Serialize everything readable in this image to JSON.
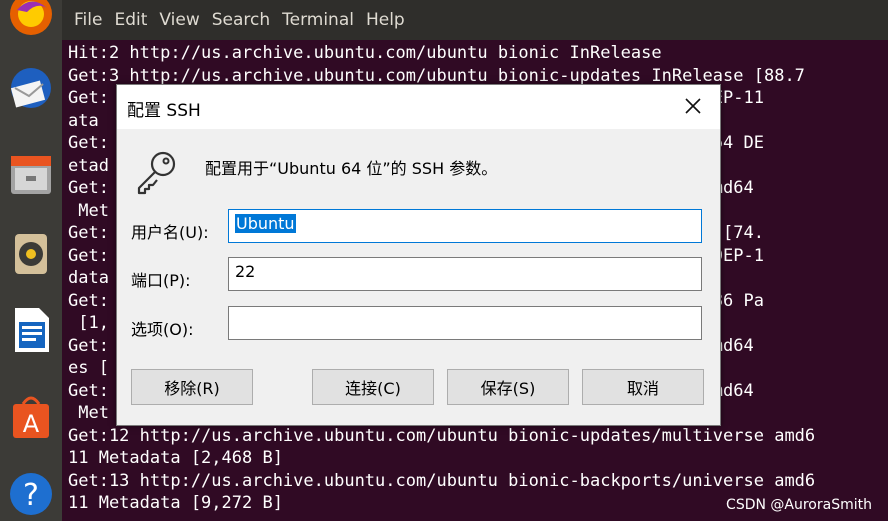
{
  "terminal": {
    "menu": [
      "File",
      "Edit",
      "View",
      "Search",
      "Terminal",
      "Help"
    ],
    "lines": [
      "Hit:2 http://us.archive.ubuntu.com/ubuntu bionic InRelease",
      "Get:3 http://us.archive.ubuntu.com/ubuntu bionic-updates InRelease [88.7",
      "Get:                                                 in amd64 DEP-11",
      "ata",
      "Get:                                                 iverse amd64 DE",
      "etad",
      "Get:                                                 ltiverse amd64",
      " Met",
      "Get:                                                  InRelease [74.",
      "Get:                                                 ain amd64 DEP-1",
      "data",
      "Get:                                                 niverse i386 Pa",
      " [1,",
      "Get:                                                 universe amd64",
      "es [",
      "Get:                                                 universe amd64",
      " Met",
      "Get:12 http://us.archive.ubuntu.com/ubuntu bionic-updates/multiverse amd6",
      "11 Metadata [2,468 B]",
      "Get:13 http://us.archive.ubuntu.com/ubuntu bionic-backports/universe amd6",
      "11 Metadata [9,272 B]"
    ]
  },
  "dialog": {
    "title": "配置 SSH",
    "description": "配置用于“Ubuntu 64 位”的 SSH 参数。",
    "username_label": "用户名(U):",
    "username_value": "Ubuntu",
    "port_label": "端口(P):",
    "port_value": "22",
    "options_label": "选项(O):",
    "options_value": "",
    "buttons": {
      "remove": "移除(R)",
      "connect": "连接(C)",
      "save": "保存(S)",
      "cancel": "取消"
    }
  },
  "watermark": "CSDN @AuroraSmith",
  "colors": {
    "terminal_bg": "#300a24",
    "dock_bg": "#3c3b37",
    "accent": "#0078d7"
  }
}
